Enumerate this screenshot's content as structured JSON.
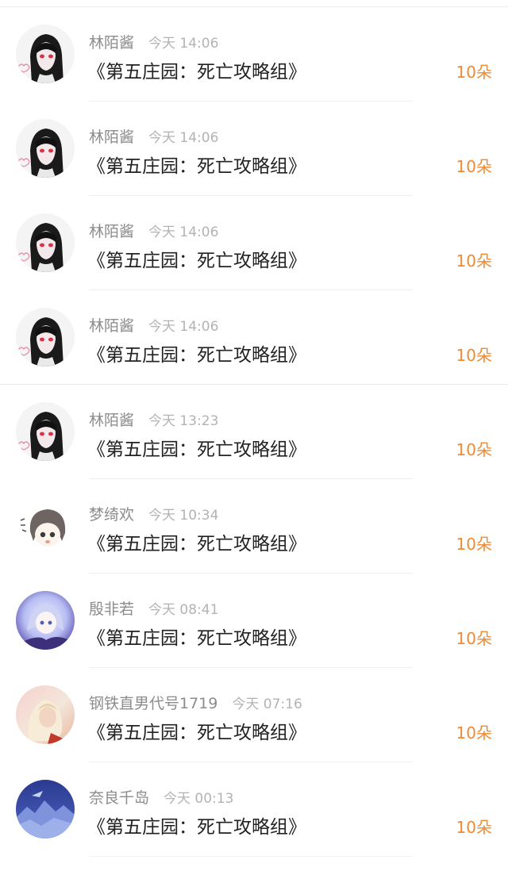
{
  "entries": [
    {
      "user": "林陌酱",
      "time": "今天 14:06",
      "item": "《第五庄园：死亡攻略组》",
      "count": "10朵",
      "avatar_icon": "anime-girl-dark-hair-icon"
    },
    {
      "user": "林陌酱",
      "time": "今天 14:06",
      "item": "《第五庄园：死亡攻略组》",
      "count": "10朵",
      "avatar_icon": "anime-girl-dark-hair-icon"
    },
    {
      "user": "林陌酱",
      "time": "今天 14:06",
      "item": "《第五庄园：死亡攻略组》",
      "count": "10朵",
      "avatar_icon": "anime-girl-dark-hair-icon"
    },
    {
      "user": "林陌酱",
      "time": "今天 14:06",
      "item": "《第五庄园：死亡攻略组》",
      "count": "10朵",
      "avatar_icon": "anime-girl-dark-hair-icon"
    },
    {
      "user": "林陌酱",
      "time": "今天 13:23",
      "item": "《第五庄园：死亡攻略组》",
      "count": "10朵",
      "avatar_icon": "anime-girl-dark-hair-icon"
    },
    {
      "user": "梦绮欢",
      "time": "今天 10:34",
      "item": "《第五庄园：死亡攻略组》",
      "count": "10朵",
      "avatar_icon": "chibi-character-icon"
    },
    {
      "user": "殷非若",
      "time": "今天 08:41",
      "item": "《第五庄园：死亡攻略组》",
      "count": "10朵",
      "avatar_icon": "anime-girl-blue-icon"
    },
    {
      "user": "钢铁直男代号1719",
      "time": "今天 07:16",
      "item": "《第五庄园：死亡攻略组》",
      "count": "10朵",
      "avatar_icon": "anime-blonde-character-icon"
    },
    {
      "user": "奈良千岛",
      "time": "今天 00:13",
      "item": "《第五庄园：死亡攻略组》",
      "count": "10朵",
      "avatar_icon": "blue-landscape-icon"
    }
  ],
  "colors": {
    "count": "#f08a32",
    "username": "#8c8c8c",
    "time": "#b3b3b3",
    "title": "#222222"
  }
}
